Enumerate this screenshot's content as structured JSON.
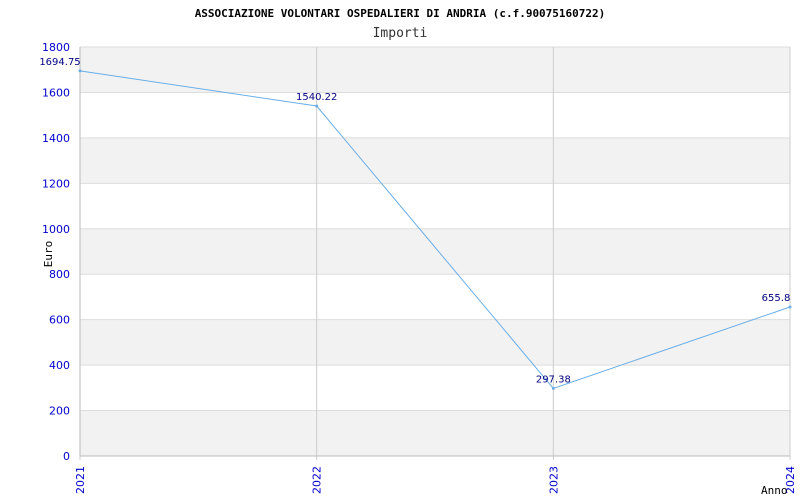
{
  "chart_data": {
    "type": "line",
    "title": "ASSOCIAZIONE VOLONTARI OSPEDALIERI DI ANDRIA (c.f.90075160722)",
    "subtitle": "Importi",
    "xlabel": "Anno",
    "ylabel": "Euro",
    "ylim": [
      0,
      1800
    ],
    "yticks": [
      "0",
      "200",
      "400",
      "600",
      "800",
      "1000",
      "1200",
      "1400",
      "1600",
      "1800"
    ],
    "categories": [
      "2021",
      "2022",
      "2023",
      "2024"
    ],
    "series": [
      {
        "values": [
          1694.75,
          1540.22,
          297.38,
          655.8
        ],
        "labels": [
          "1694.75",
          "1540.22",
          "297.38",
          "655.8"
        ]
      }
    ],
    "grid": true,
    "colors": {
      "line": "#6aaee8",
      "band": "#f2f2f2",
      "grid": "#dddddd",
      "tick": "#0000cc",
      "data_label": "#000080"
    }
  }
}
